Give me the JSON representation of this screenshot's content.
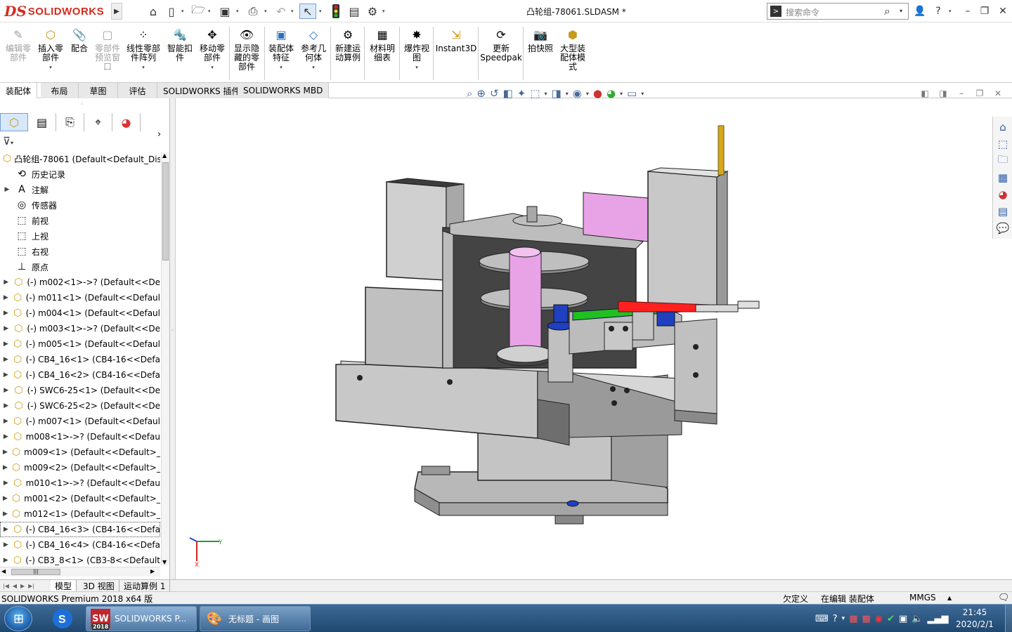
{
  "window": {
    "file_title": "凸轮组-78061.SLDASM *",
    "app_logo_mark": "DS",
    "app_logo_text": "SOLIDWORKS",
    "search_placeholder": "搜索命令"
  },
  "quick_access": [
    "home-icon",
    "new-doc-icon",
    "open-icon",
    "save-icon",
    "print-icon",
    "undo-icon",
    "select-icon",
    "traffic-light-icon",
    "file-props-icon",
    "options-icon"
  ],
  "ribbon": {
    "commands": [
      {
        "label": "编辑零\n部件",
        "disabled": true,
        "icon": "edit-component-icon",
        "dropdown": false
      },
      {
        "label": "插入零\n部件",
        "disabled": false,
        "icon": "insert-component-icon",
        "dropdown": true
      },
      {
        "label": "配合",
        "disabled": false,
        "icon": "mate-icon",
        "dropdown": false
      },
      {
        "label": "零部件\n预览窗\n口",
        "disabled": true,
        "icon": "preview-window-icon",
        "dropdown": false
      },
      {
        "label": "线性零部\n件阵列",
        "disabled": false,
        "icon": "linear-pattern-icon",
        "dropdown": true
      },
      {
        "label": "智能扣\n件",
        "disabled": false,
        "icon": "smart-fastener-icon",
        "dropdown": false
      },
      {
        "label": "移动零\n部件",
        "disabled": false,
        "icon": "move-component-icon",
        "dropdown": true
      },
      {
        "label": "显示隐\n藏的零\n部件",
        "disabled": false,
        "icon": "show-hidden-icon",
        "dropdown": false
      },
      {
        "label": "装配体\n特征",
        "disabled": false,
        "icon": "assembly-feature-icon",
        "dropdown": true
      },
      {
        "label": "参考几\n何体",
        "disabled": false,
        "icon": "ref-geometry-icon",
        "dropdown": true
      },
      {
        "label": "新建运\n动算例",
        "disabled": false,
        "icon": "motion-study-icon",
        "dropdown": false
      },
      {
        "label": "材料明\n细表",
        "disabled": false,
        "icon": "bom-icon",
        "dropdown": false
      },
      {
        "label": "爆炸视\n图",
        "disabled": false,
        "icon": "exploded-view-icon",
        "dropdown": true
      },
      {
        "label": "Instant3D",
        "disabled": false,
        "icon": "instant3d-icon",
        "dropdown": false
      },
      {
        "label": "更新\nSpeedpak",
        "disabled": false,
        "icon": "speedpak-icon",
        "dropdown": false
      },
      {
        "label": "拍快照",
        "disabled": false,
        "icon": "snapshot-icon",
        "dropdown": false
      },
      {
        "label": "大型装\n配体模\n式",
        "disabled": false,
        "icon": "large-assembly-icon",
        "dropdown": false
      }
    ]
  },
  "command_tabs": [
    "装配体",
    "布局",
    "草图",
    "评估",
    "SOLIDWORKS 插件",
    "SOLIDWORKS MBD"
  ],
  "panel_tabs": [
    "feature-manager-icon",
    "property-manager-icon",
    "configuration-manager-icon",
    "dimxpert-icon",
    "display-manager-icon"
  ],
  "tree": {
    "root": "凸轮组-78061  (Default<Default_Dis",
    "items": [
      {
        "label": "历史记录",
        "icon": "history-icon",
        "expand": false
      },
      {
        "label": "注解",
        "icon": "annotation-icon",
        "expand": true
      },
      {
        "label": "传感器",
        "icon": "sensor-icon",
        "expand": false
      },
      {
        "label": "前视",
        "icon": "plane-icon",
        "expand": false
      },
      {
        "label": "上视",
        "icon": "plane-icon",
        "expand": false
      },
      {
        "label": "右视",
        "icon": "plane-icon",
        "expand": false
      },
      {
        "label": "原点",
        "icon": "origin-icon",
        "expand": false
      },
      {
        "label": "(-) m002<1>->? (Default<<De",
        "icon": "part-icon",
        "expand": true
      },
      {
        "label": "(-) m011<1> (Default<<Defaul",
        "icon": "part-icon",
        "expand": true
      },
      {
        "label": "(-) m004<1> (Default<<Defaul",
        "icon": "part-icon",
        "expand": true
      },
      {
        "label": "(-) m003<1>->? (Default<<De",
        "icon": "part-icon",
        "expand": true
      },
      {
        "label": "(-) m005<1> (Default<<Defaul",
        "icon": "part-icon",
        "expand": true
      },
      {
        "label": "(-) CB4_16<1> (CB4-16<<Defa",
        "icon": "part-icon",
        "expand": true
      },
      {
        "label": "(-) CB4_16<2> (CB4-16<<Defa",
        "icon": "part-icon",
        "expand": true
      },
      {
        "label": "(-) SWC6-25<1> (Default<<De",
        "icon": "part-icon",
        "expand": true
      },
      {
        "label": "(-) SWC6-25<2> (Default<<De",
        "icon": "part-icon",
        "expand": true
      },
      {
        "label": "(-) m007<1> (Default<<Defaul",
        "icon": "part-icon",
        "expand": true
      },
      {
        "label": "m008<1>->? (Default<<Defau",
        "icon": "part-icon",
        "expand": true
      },
      {
        "label": "m009<1> (Default<<Default>_",
        "icon": "part-icon",
        "expand": true
      },
      {
        "label": "m009<2> (Default<<Default>_",
        "icon": "part-icon",
        "expand": true
      },
      {
        "label": "m010<1>->? (Default<<Defau",
        "icon": "part-icon",
        "expand": true
      },
      {
        "label": "m001<2> (Default<<Default>_",
        "icon": "part-icon",
        "expand": true
      },
      {
        "label": "m012<1> (Default<<Default>_",
        "icon": "part-icon",
        "expand": true
      },
      {
        "label": "(-) CB4_16<3> (CB4-16<<Defa",
        "icon": "part-icon",
        "expand": true,
        "selected": true
      },
      {
        "label": "(-) CB4_16<4> (CB4-16<<Defa",
        "icon": "part-icon",
        "expand": true
      },
      {
        "label": "(-) CB3_8<1> (CB3-8<<Default",
        "icon": "part-icon",
        "expand": true
      }
    ]
  },
  "viewport": {
    "triad": {
      "x": "X",
      "y": "Y"
    }
  },
  "heads_up_toolbar": [
    "zoom-fit-icon",
    "zoom-area-icon",
    "previous-view-icon",
    "section-view-icon",
    "dynamic-annotation-icon",
    "view-orientation-icon",
    "display-style-icon",
    "hide-show-icon",
    "edit-appearance-icon",
    "apply-scene-icon",
    "view-settings-icon"
  ],
  "task_pane": [
    "sw-resources-icon",
    "design-library-icon",
    "file-explorer-icon",
    "view-palette-icon",
    "appearances-icon",
    "custom-props-icon",
    "forum-icon"
  ],
  "bottom_tabs": [
    "模型",
    "3D 视图",
    "运动算例 1"
  ],
  "status": {
    "app": "SOLIDWORKS Premium 2018 x64 版",
    "definition": "欠定义",
    "mode": "在编辑 装配体",
    "units": "MMGS",
    "units_arrow": "▲"
  },
  "taskbar": {
    "apps": [
      {
        "label": "SOLIDWORKS P...",
        "icon": "solidworks-app-icon",
        "badge": "2018"
      },
      {
        "label": "无标题 - 画图",
        "icon": "paint-app-icon"
      }
    ],
    "time": "21:45",
    "date": "2020/2/1"
  },
  "colors": {
    "brand_red": "#d52b1e",
    "model_gray": "#bdbdbd",
    "model_pink": "#e8a3e6",
    "model_blue": "#2040c0",
    "model_red": "#ff2020",
    "model_green": "#20c020",
    "taskbar_blue": "#2d5a86"
  }
}
